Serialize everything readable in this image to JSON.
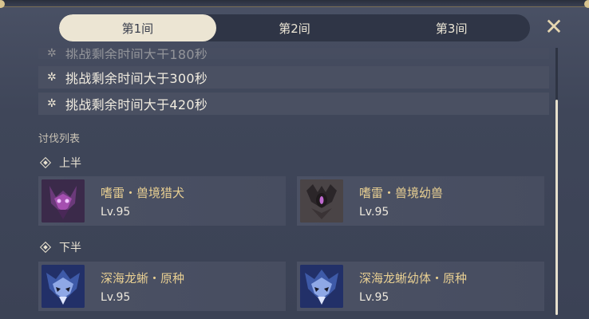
{
  "tabs": [
    {
      "label": "第1间",
      "active": true
    },
    {
      "label": "第2间",
      "active": false
    },
    {
      "label": "第3间",
      "active": false
    }
  ],
  "close_icon": "close-icon",
  "conditions": [
    {
      "text": "挑战剩余时间大于180秒",
      "icon": "star-icon"
    },
    {
      "text": "挑战剩余时间大于300秒",
      "icon": "star-icon"
    },
    {
      "text": "挑战剩余时间大于420秒",
      "icon": "star-icon"
    }
  ],
  "enemy_list_title": "讨伐列表",
  "halves": [
    {
      "label": "上半",
      "enemies": [
        {
          "name": "嗜雷・兽境猎犬",
          "level": "Lv.95"
        },
        {
          "name": "嗜雷・兽境幼兽",
          "level": "Lv.95"
        }
      ]
    },
    {
      "label": "下半",
      "enemies": [
        {
          "name": "深海龙蜥・原种",
          "level": "Lv.95"
        },
        {
          "name": "深海龙蜥幼体・原种",
          "level": "Lv.95"
        }
      ]
    }
  ],
  "colors": {
    "accent_gold": "#e8cf92",
    "tab_active_bg": "#ece5d3",
    "panel_bg": "#3e4559"
  }
}
